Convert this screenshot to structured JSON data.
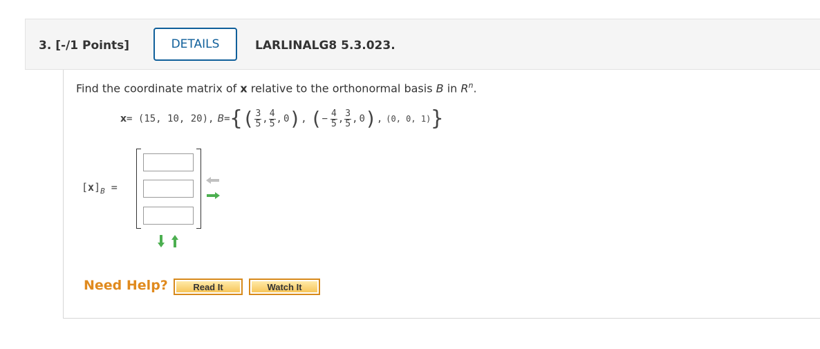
{
  "header": {
    "question_number": "3. [-/1 Points]",
    "details_label": "DETAILS",
    "source": "LARLINALG8 5.3.023."
  },
  "prompt": {
    "before": "Find the coordinate matrix of ",
    "bold_x": "x",
    "middle": " relative to the orthonormal basis ",
    "B": "B",
    "in": " in ",
    "R": "R",
    "n": "n",
    "end": "."
  },
  "equation": {
    "x_label": "x",
    "x_value": " = (15, 10, 20),",
    "B_label": "B",
    "B_eq": " = ",
    "v1": {
      "a_num": "3",
      "a_den": "5",
      "b_num": "4",
      "b_den": "5",
      "c": "0"
    },
    "v2": {
      "a_sign": "−",
      "a_num": "4",
      "a_den": "5",
      "b_num": "3",
      "b_den": "5",
      "c": "0"
    },
    "v3": "(0, 0, 1)"
  },
  "answer": {
    "lhs_open": "[",
    "lhs_x": "x",
    "lhs_close": "]",
    "lhs_sub": "B",
    "lhs_eq": " =",
    "cells": [
      "",
      "",
      ""
    ]
  },
  "help": {
    "label": "Need Help?",
    "read_it": "Read It",
    "watch_it": "Watch It"
  },
  "colors": {
    "details_border": "#0f5f9a",
    "help_orange": "#e08a1e",
    "arrow_green": "#4caf50",
    "arrow_gray": "#c0c0c0"
  }
}
